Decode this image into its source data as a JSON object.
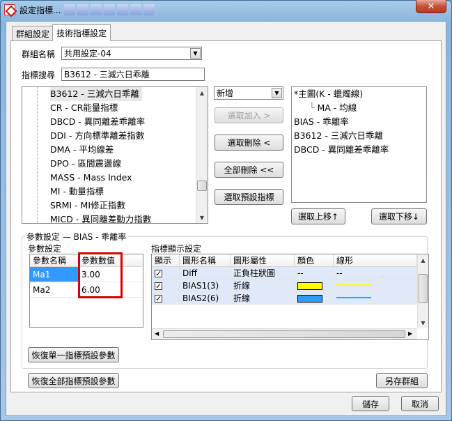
{
  "window": {
    "title": "設定指標...",
    "close": "✕"
  },
  "tabs": [
    {
      "label": "群組設定"
    },
    {
      "label": "技術指標設定"
    }
  ],
  "group_name": {
    "label": "群組名稱",
    "value": "共用設定-04"
  },
  "search": {
    "label": "指標搜尋",
    "value": "B3612 - 三減六日乖離"
  },
  "indicator_list": [
    "B3612 - 三減六日乖離",
    "CR - CR能量指標",
    "DBCD - 異同離差乖離率",
    "DDI - 方向標準離差指數",
    "DMA - 平均線差",
    "DPO - 區間震盪線",
    "MASS - Mass Index",
    "MI - 動量指標",
    "SRMI - MI修正指數",
    "MICD - 異同離差動力指數"
  ],
  "add_mode": {
    "value": "新增"
  },
  "buttons": {
    "add_selected": "選取加入 >",
    "delete_selected": "選取刪除 <",
    "delete_all": "全部刪除 <<",
    "select_default": "選取預設指標",
    "move_up": "選取上移↑",
    "move_down": "選取下移↓",
    "restore_single": "恢復單一指標預設參數",
    "restore_all": "恢復全部指標預設參數",
    "save_as_group": "另存群組",
    "save": "儲存",
    "cancel": "取消"
  },
  "selected_list": [
    {
      "label": "*主圖(K - 蠟燭線)",
      "indent": 0
    },
    {
      "label": "MA - 均線",
      "indent": 1
    },
    {
      "label": "BIAS - 乖離率",
      "indent": 0
    },
    {
      "label": "B3612 - 三減六日乖離",
      "indent": 0
    },
    {
      "label": "DBCD - 異同離差乖離率",
      "indent": 0
    }
  ],
  "param_section": {
    "title": "參數設定",
    "indicator": "BIAS - 乖離率",
    "sub_label": "參數設定",
    "columns": [
      "參數名稱",
      "參數數值"
    ],
    "rows": [
      {
        "name": "Ma1",
        "value": "3.00"
      },
      {
        "name": "Ma2",
        "value": "6.00"
      }
    ]
  },
  "display_section": {
    "label": "指標顯示設定",
    "columns": [
      "顯示",
      "圖形名稱",
      "圖形屬性",
      "顏色",
      "線形"
    ],
    "rows": [
      {
        "checked": true,
        "name": "Diff",
        "attr": "正負柱狀圖",
        "color": "--",
        "line": "--"
      },
      {
        "checked": true,
        "name": "BIAS1(3)",
        "attr": "折線",
        "color": "#ffff00",
        "line": "#ffff00"
      },
      {
        "checked": true,
        "name": "BIAS2(6)",
        "attr": "折線",
        "color": "#3399ff",
        "line": "#3399ff"
      }
    ]
  }
}
